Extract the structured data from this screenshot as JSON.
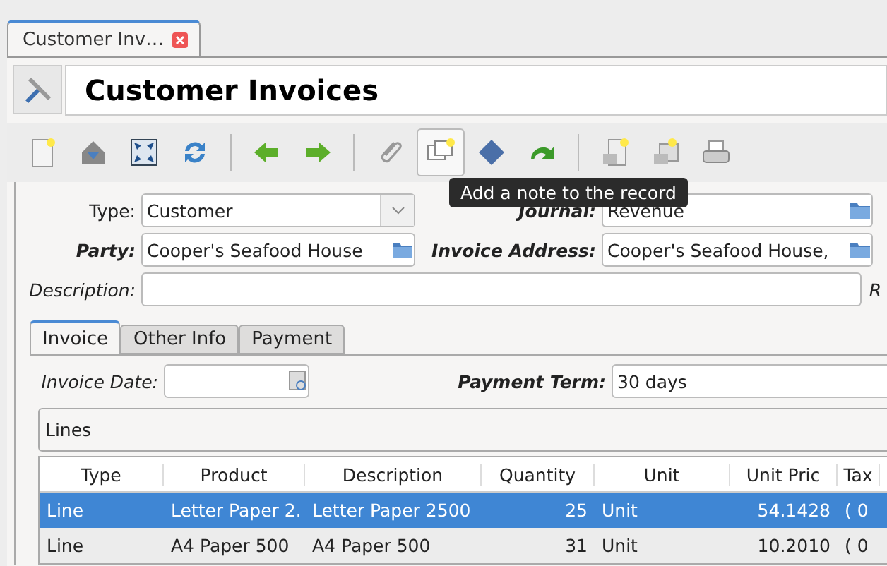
{
  "document_tab": {
    "label": "Customer Inv…",
    "selected": true
  },
  "title": "Customer Invoices",
  "toolbar": {
    "buttons": [
      {
        "kind": "new",
        "selected": false
      },
      {
        "kind": "save",
        "selected": false
      },
      {
        "kind": "switch",
        "selected": false
      },
      {
        "kind": "reload",
        "selected": false
      },
      {
        "kind": "sep"
      },
      {
        "kind": "previous",
        "selected": false
      },
      {
        "kind": "next",
        "selected": false
      },
      {
        "kind": "sep"
      },
      {
        "kind": "attach",
        "selected": false
      },
      {
        "kind": "note",
        "selected": true
      },
      {
        "kind": "action",
        "selected": false
      },
      {
        "kind": "relate",
        "selected": false
      },
      {
        "kind": "sep"
      },
      {
        "kind": "report",
        "selected": false
      },
      {
        "kind": "email",
        "selected": false
      },
      {
        "kind": "print",
        "selected": false
      }
    ],
    "tooltip": "Add a note to the record"
  },
  "form": {
    "type": {
      "label": "Type:",
      "value": "Customer"
    },
    "journal": {
      "label": "Journal:",
      "value": "Revenue"
    },
    "party": {
      "label": "Party:",
      "value": "Cooper's Seafood House"
    },
    "invoice_address": {
      "label": "Invoice Address:",
      "value": "Cooper's Seafood House,"
    },
    "description": {
      "label": "Description:"
    },
    "cut_label": "R"
  },
  "tabs": [
    {
      "label": "Invoice",
      "selected": true
    },
    {
      "label": "Other Info",
      "selected": false
    },
    {
      "label": "Payment",
      "selected": false
    }
  ],
  "invoice_date": {
    "label": "Invoice Date:"
  },
  "payment_term": {
    "label": "Payment Term:",
    "value": "30 days"
  },
  "lines": {
    "title": "Lines",
    "columns": [
      "Type",
      "Product",
      "Description",
      "Quantity",
      "Unit",
      "Unit Pric",
      "Tax"
    ],
    "rows": [
      {
        "selected": true,
        "cells": [
          "Line",
          "Letter Paper 2.",
          "Letter Paper 2500",
          "25",
          "Unit",
          "54.1428",
          "( 0"
        ]
      },
      {
        "selected": false,
        "cells": [
          "Line",
          "A4 Paper 500",
          "A4 Paper 500",
          "31",
          "Unit",
          "10.2010",
          "( 0"
        ]
      }
    ]
  }
}
